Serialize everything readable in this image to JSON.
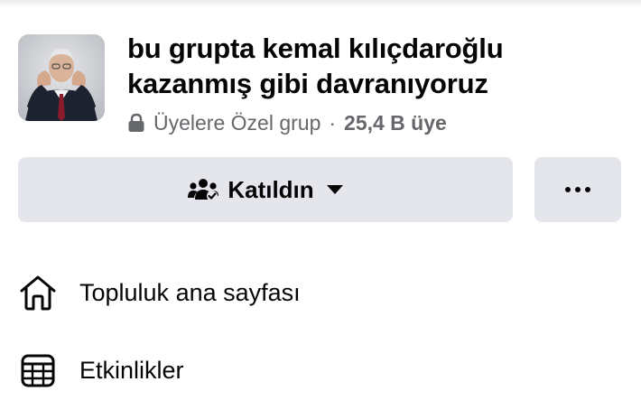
{
  "group": {
    "title_line1": "bu grupta kemal kılıçdaroğlu",
    "title_line2": "kazanmış gibi davranıyoruz",
    "privacy": "Üyelere Özel grup",
    "separator": "·",
    "members": "25,4 B üye",
    "avatar_icon": "group-avatar-photo"
  },
  "actions": {
    "joined_label": "Katıldın",
    "joined_icon": "people-check-icon",
    "dropdown_icon": "caret-down-icon",
    "more_icon": "more-dots-icon"
  },
  "nav": [
    {
      "label": "Topluluk ana sayfası",
      "icon": "home-icon"
    },
    {
      "label": "Etkinlikler",
      "icon": "calendar-icon"
    }
  ],
  "colors": {
    "text_primary": "#050505",
    "text_secondary": "#65676b",
    "button_bg": "#e4e6eb"
  }
}
